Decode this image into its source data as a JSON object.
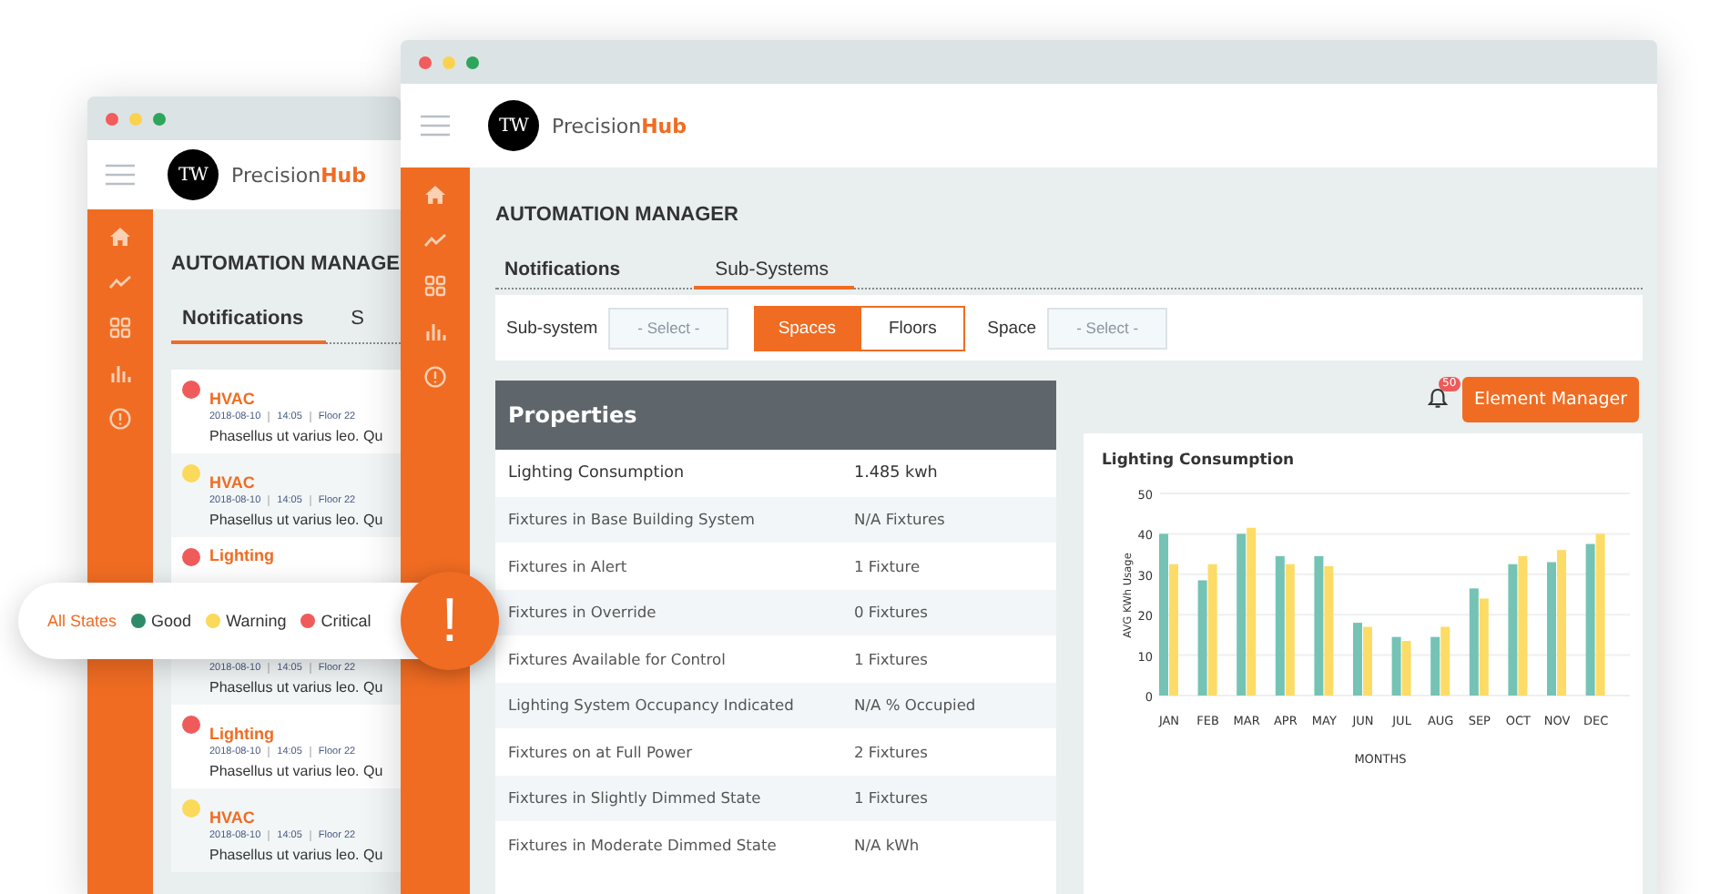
{
  "back_window": {
    "logo_mark": "TW",
    "brand": {
      "name": "Precision",
      "accent": "Hub"
    },
    "title": "AUTOMATION MANAGE",
    "tabs": [
      {
        "label": "Notifications",
        "selected": true
      },
      {
        "label": "S",
        "selected": false
      }
    ],
    "notifications": [
      {
        "title": "HVAC",
        "color": "#ef5b5b",
        "meta": [
          "2018-08-10",
          "14:05",
          "Floor 22"
        ],
        "text": "Phasellus ut varius leo. Qu"
      },
      {
        "title": "HVAC",
        "color": "#fbd95a",
        "meta": [
          "2018-08-10",
          "14:05",
          "Floor 22"
        ],
        "text": "Phasellus ut varius leo. Qu"
      },
      {
        "title": "Lighting",
        "color": "#ef5b5b"
      },
      {
        "meta": [
          "2018-08-10",
          "14:05",
          "Floor 22"
        ],
        "text": "Phasellus ut varius leo. Qu"
      },
      {
        "title": "Lighting",
        "color": "#ef5b5b",
        "meta": [
          "2018-08-10",
          "14:05",
          "Floor 22"
        ],
        "text": "Phasellus ut varius leo. Qu"
      },
      {
        "title": "HVAC",
        "color": "#fbd95a",
        "meta": [
          "2018-08-10",
          "14:05",
          "Floor 22"
        ],
        "text": "Phasellus ut varius leo. Qu"
      }
    ]
  },
  "front_window": {
    "logo_mark": "TW",
    "brand": {
      "name": "Precision",
      "accent": "Hub"
    },
    "title": "AUTOMATION MANAGER",
    "tabs": [
      {
        "label": "Notifications",
        "selected": false
      },
      {
        "label": "Sub-Systems",
        "selected": true
      }
    ],
    "filters": {
      "subsystem_label": "Sub-system",
      "subsystem_placeholder": "- Select -",
      "toggle": [
        {
          "label": "Spaces",
          "selected": true
        },
        {
          "label": "Floors",
          "selected": false
        }
      ],
      "space_label": "Space",
      "space_placeholder": "- Select -"
    },
    "properties": {
      "title": "Properties",
      "rows": [
        {
          "name": "Lighting Consumption",
          "value": "1.485 kwh"
        },
        {
          "name": "Fixtures in Base Building System",
          "value": "N/A Fixtures"
        },
        {
          "name": "Fixtures in Alert",
          "value": "1 Fixture"
        },
        {
          "name": "Fixtures in Override",
          "value": "0 Fixtures"
        },
        {
          "name": "Fixtures Available for Control",
          "value": "1 Fixtures"
        },
        {
          "name": "Lighting System Occupancy Indicated",
          "value": "N/A % Occupied"
        },
        {
          "name": "Fixtures on at Full Power",
          "value": "2 Fixtures"
        },
        {
          "name": "Fixtures in Slightly Dimmed State",
          "value": "1 Fixtures"
        },
        {
          "name": "Fixtures in Moderate Dimmed State",
          "value": "N/A kWh"
        }
      ]
    },
    "notification_badge": "50",
    "element_manager_button": "Element Manager",
    "chart_card": {
      "title": "Lighting Consumption",
      "chart_data": {
        "type": "bar",
        "xlabel": "MONTHS",
        "ylabel": "AVG KWh Usage",
        "categories": [
          "JAN",
          "FEB",
          "MAR",
          "APR",
          "MAY",
          "JUN",
          "JUL",
          "AUG",
          "SEP",
          "OCT",
          "NOV",
          "DEC"
        ],
        "series": [
          {
            "color": "#74c3b5",
            "values": [
              40,
              28.5,
              40,
              34.5,
              34.5,
              18,
              14.5,
              14.5,
              26.5,
              32.5,
              33,
              37.5
            ]
          },
          {
            "color": "#fcdc66",
            "values": [
              32.5,
              32.5,
              41.5,
              32.5,
              32,
              17,
              13.5,
              17,
              24,
              34.5,
              36,
              40
            ]
          }
        ],
        "ylim": [
          0,
          50
        ],
        "grid": true,
        "yticks": [
          0,
          10,
          20,
          30,
          40,
          50
        ]
      }
    }
  },
  "state_filter": [
    {
      "label": "All States",
      "selected": true
    },
    {
      "label": "Good",
      "selected": false,
      "color": "#2e8b6a"
    },
    {
      "label": "Warning",
      "selected": false,
      "color": "#fbd95a"
    },
    {
      "label": "Critical",
      "selected": false,
      "color": "#ef5b5b"
    }
  ],
  "alert_symbol": "!"
}
